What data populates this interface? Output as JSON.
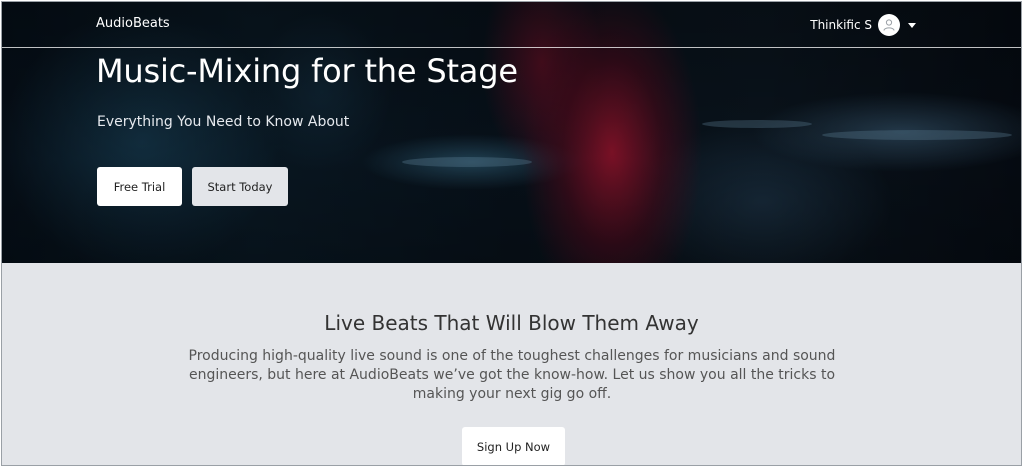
{
  "nav": {
    "brand": "AudioBeats",
    "user_name": "Thinkific S"
  },
  "hero": {
    "title": "Music-Mixing for the Stage",
    "subtitle": "Everything You Need to Know About",
    "buttons": {
      "free_trial": "Free Trial",
      "start_today": "Start Today"
    }
  },
  "section": {
    "title": "Live Beats That Will Blow Them Away",
    "body": "Producing high-quality live sound is one of the toughest challenges for musicians and sound engineers, but here at AudioBeats we’ve got the know-how. Let us show you all the tricks to making your next gig go off.",
    "cta": "Sign Up Now"
  },
  "icons": {
    "avatar": "user-avatar-icon",
    "dropdown": "caret-down-icon"
  },
  "colors": {
    "section_bg": "#e3e5e9",
    "hero_accent": "#96142d",
    "button_bg": "#ffffff"
  }
}
